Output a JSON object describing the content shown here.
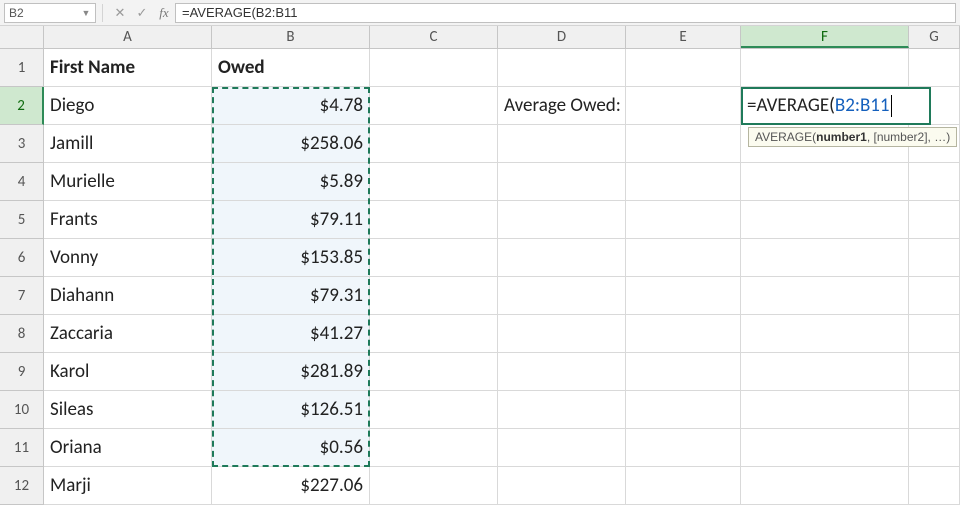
{
  "formula_bar": {
    "name_box": "B2",
    "formula_text": "=AVERAGE(B2:B11"
  },
  "columns": [
    "A",
    "B",
    "C",
    "D",
    "E",
    "F",
    "G"
  ],
  "row_numbers": [
    "1",
    "2",
    "3",
    "4",
    "5",
    "6",
    "7",
    "8",
    "9",
    "10",
    "11",
    "12"
  ],
  "headers": {
    "A": "First Name",
    "B": "Owed"
  },
  "names": [
    "Diego",
    "Jamill",
    "Murielle",
    "Frants",
    "Vonny",
    "Diahann",
    "Zaccaria",
    "Karol",
    "Sileas",
    "Oriana",
    "Marji"
  ],
  "owed": [
    "$4.78",
    "$258.06",
    "$5.89",
    "$79.11",
    "$153.85",
    "$79.31",
    "$41.27",
    "$281.89",
    "$126.51",
    "$0.56",
    "$227.06"
  ],
  "label_d2": "Average Owed:",
  "active_cell": {
    "equals": "=",
    "fn": "AVERAGE(",
    "ref": "B2:B11"
  },
  "tooltip": {
    "fn": "AVERAGE",
    "sig_bold": "number1",
    "sig_rest": ", [number2], …)"
  },
  "icons": {
    "dropdown": "▼",
    "cancel": "✕",
    "enter": "✓",
    "fx": "fx"
  }
}
